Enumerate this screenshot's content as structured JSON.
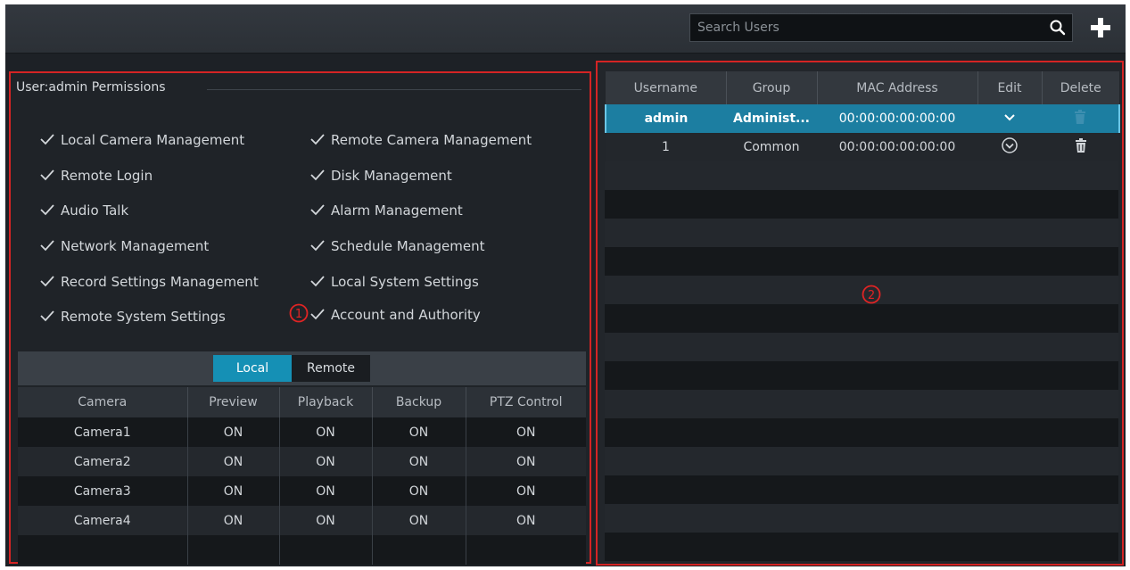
{
  "search": {
    "placeholder": "Search Users",
    "icon": "search-icon"
  },
  "add_button_icon": "plus-icon",
  "permissions": {
    "header": "User:admin Permissions",
    "items": [
      "Local Camera Management",
      "Remote Camera Management",
      "Remote Login",
      "Disk Management",
      "Audio Talk",
      "Alarm Management",
      "Network Management",
      "Schedule Management",
      "Record Settings Management",
      "Local System Settings",
      "Remote System Settings",
      "Account and Authority"
    ]
  },
  "markers": {
    "one": "1",
    "two": "2"
  },
  "camera_tabs": {
    "active": "Local",
    "labels": [
      "Local",
      "Remote"
    ]
  },
  "camera_table": {
    "headers": [
      "Camera",
      "Preview",
      "Playback",
      "Backup",
      "PTZ Control"
    ],
    "rows": [
      [
        "Camera1",
        "ON",
        "ON",
        "ON",
        "ON"
      ],
      [
        "Camera2",
        "ON",
        "ON",
        "ON",
        "ON"
      ],
      [
        "Camera3",
        "ON",
        "ON",
        "ON",
        "ON"
      ],
      [
        "Camera4",
        "ON",
        "ON",
        "ON",
        "ON"
      ]
    ]
  },
  "users_table": {
    "headers": [
      "Username",
      "Group",
      "MAC Address",
      "Edit",
      "Delete"
    ],
    "rows": [
      {
        "username": "admin",
        "group": "Administ...",
        "mac": "00:00:00:00:00:00",
        "selected": true
      },
      {
        "username": "1",
        "group": "Common",
        "mac": "00:00:00:00:00:00",
        "selected": false
      }
    ]
  },
  "colors": {
    "accent": "#1590b5",
    "selected_row": "#1c7ea1",
    "callout_border": "#d42424"
  }
}
